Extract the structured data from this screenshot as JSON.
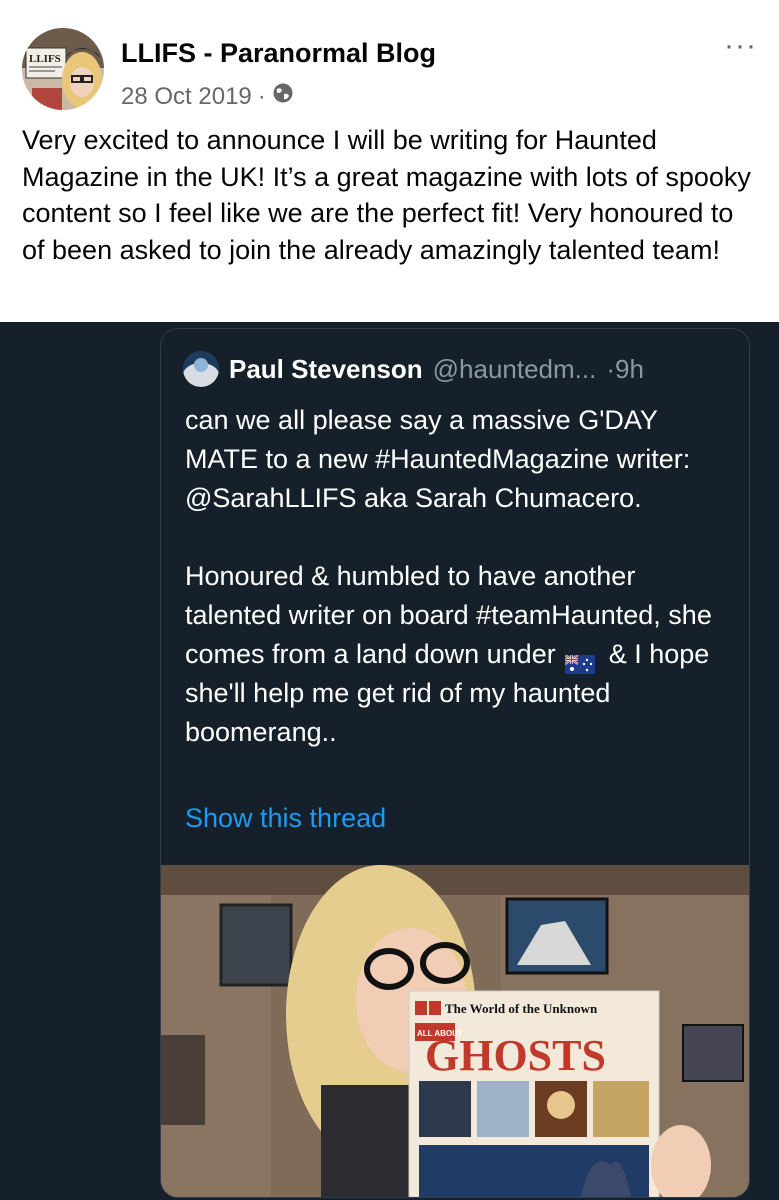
{
  "post": {
    "author": "LLIFS - Paranormal Blog",
    "date": "28 Oct 2019",
    "separator": "·",
    "more_label": "···",
    "avatar_text": "LLIFS",
    "text": "Very excited to announce I will be writing for Haunted Magazine in the UK!  It’s a great magazine with lots of spooky content so I feel like we are the perfect fit! Very honoured to of been asked to join the already amazingly talented team!"
  },
  "tweet": {
    "name": "Paul Stevenson",
    "handle": "@hauntedm...",
    "time": "·9h",
    "paragraph1": "can we all please say a massive G'DAY MATE to a new #HauntedMagazine writer: @SarahLLIFS aka Sarah Chumacero.",
    "paragraph2_before_flag": "Honoured & humbled to have another talented writer on board #teamHaunted, she comes from a land down under",
    "paragraph2_after_flag": "& I hope she'll help me get rid of my haunted boomerang..",
    "show_thread": "Show this thread",
    "photo": {
      "book_series": "The World of the Unknown",
      "book_badge": "ALL ABOUT",
      "book_title": "GHOSTS"
    }
  },
  "colors": {
    "fb_text": "#050505",
    "fb_meta": "#65676b",
    "tweet_bg": "#15202b",
    "tweet_link": "#1d9bf0",
    "tweet_muted": "#8899a6",
    "book_title": "#c0392b"
  },
  "icons": {
    "privacy": "globe-icon",
    "more": "more-options-icon",
    "flag": "australia-flag-icon"
  }
}
